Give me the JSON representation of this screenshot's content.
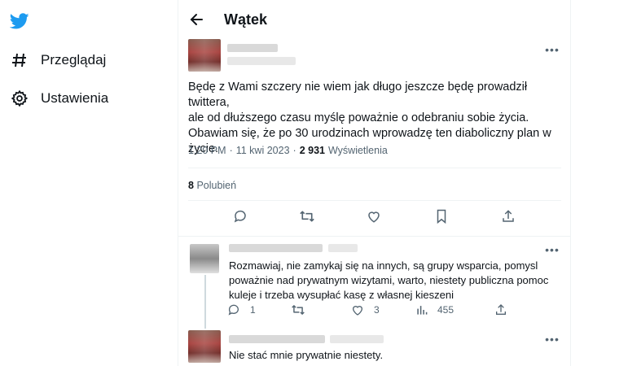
{
  "sidebar": {
    "logo": "twitter-bird-icon",
    "items": [
      {
        "icon": "hashtag-icon",
        "label": "Przeglądaj"
      },
      {
        "icon": "gear-icon",
        "label": "Ustawienia"
      }
    ]
  },
  "header": {
    "title": "Wątek"
  },
  "tweet": {
    "text": "Będę z Wami szczery nie wiem jak długo jeszcze będę prowadził twittera,\nale od dłuższego czasu myślę poważnie o odebraniu sobie życia.\nObawiam się, że po 30 urodzinach wprowadzę ten diaboliczny plan w\nżycie.",
    "time": "1:20 PM",
    "sep": "·",
    "date": "11 kwi 2023",
    "views_count": "2 931",
    "views_label": "Wyświetlenia",
    "likes_count": "8",
    "likes_label": "Polubień"
  },
  "replies": [
    {
      "text": "Rozmawiaj, nie zamykaj się na innych, są grupy wsparcia, pomysl\npoważnie nad prywatnym wizytami, warto, niestety publiczna pomoc\nkuleje i trzeba wysupłać kasę z własnej kieszeni",
      "reply_count": "1",
      "like_count": "3",
      "view_count": "455"
    },
    {
      "text": "Nie stać mnie prywatnie niestety."
    }
  ],
  "colors": {
    "brand": "#1d9bf0",
    "text": "#0f1419",
    "muted": "#536471"
  }
}
